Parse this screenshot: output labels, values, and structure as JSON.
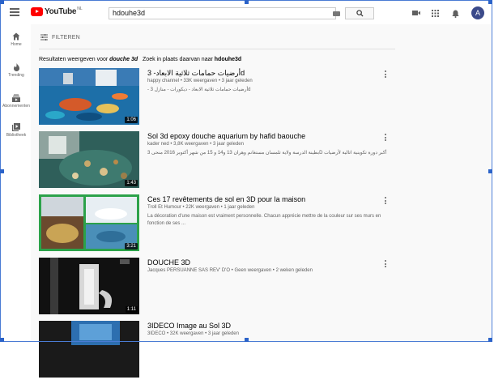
{
  "header": {
    "logo_text": "YouTube",
    "country_code": "NL",
    "search_value": "hdouhe3d",
    "avatar_letter": "A"
  },
  "sidebar": {
    "items": [
      {
        "label": "Home",
        "icon": "home-icon"
      },
      {
        "label": "Trending",
        "icon": "trending-icon"
      },
      {
        "label": "Abonnementen",
        "icon": "subscriptions-icon"
      },
      {
        "label": "Bibliotheek",
        "icon": "library-icon"
      }
    ]
  },
  "filter": {
    "label": "FILTEREN"
  },
  "correction": {
    "prefix": "Resultaten weergeven voor",
    "corrected": "douche 3d",
    "instead_prefix": "Zoek in plaats daarvan naar",
    "original": "hdouhe3d"
  },
  "videos": [
    {
      "title": "3 -أرضيات حمامات ثلاثية الابعاد‏d",
      "channel": "happy channel",
      "views": "33K weergaven",
      "age": "3 jaar geleden",
      "description": "- أرضيات حمامات ثلاثية الابعاد - ديكورات - منازل 3d",
      "duration": "1:06"
    },
    {
      "title": "Sol 3d epoxy douche aquarium by hafid baouche",
      "channel": "kader ned",
      "views": "3,8K weergaven",
      "age": "3 jaar geleden",
      "description": "بطينة الدرسة ولاية تلمسان مستغانم وهران 13 و14 و 15 من شهر أكتوبر 2016 منحى 3D أكبر دورة تكوينية اتالية لأرضيات",
      "duration": "1:43"
    },
    {
      "title": "Ces 17 revêtements de sol en 3D pour la maison",
      "channel": "Troll Et Humour",
      "views": "22K weergaven",
      "age": "1 jaar geleden",
      "description": "La décoration d'une maison est vraiment personnelle. Chacun apprécie mettre de la couleur sur ses murs en fonction de ses ...",
      "duration": "3:21"
    },
    {
      "title": "DOUCHE 3D",
      "channel": "Jacques PERSUANNE SAS REV' D'O",
      "views": "Geen weergaven",
      "age": "2 weken geleden",
      "description": "",
      "duration": "1:11"
    },
    {
      "title": "3IDECO Image au Sol 3D",
      "channel": "3IDECO",
      "views": "32K weergaven",
      "age": "3 jaar geleden",
      "description": "",
      "duration": ""
    }
  ]
}
